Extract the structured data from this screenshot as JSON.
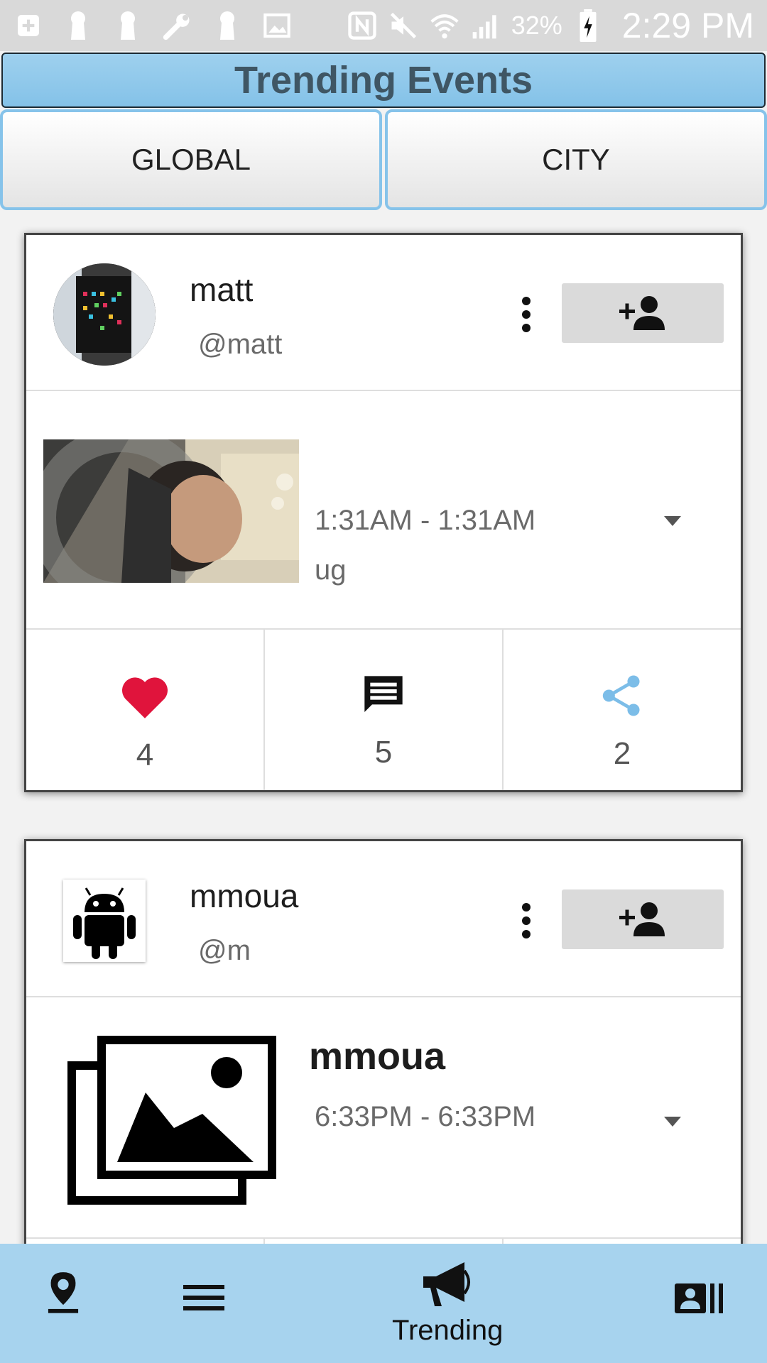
{
  "status_bar": {
    "battery": "32%",
    "time": "2:29 PM",
    "icons": [
      "add-box-icon",
      "keyhole-icon",
      "keyhole-icon",
      "wrench-icon",
      "keyhole-icon",
      "image-icon",
      "nfc-icon",
      "mute-icon",
      "wifi-icon",
      "signal-icon",
      "battery-charging-icon"
    ]
  },
  "header": {
    "title": "Trending Events"
  },
  "tabs": [
    {
      "label": "GLOBAL"
    },
    {
      "label": "CITY"
    }
  ],
  "posts": [
    {
      "username": "matt",
      "handle": "@matt",
      "time": "1:31AM - 1:31AM",
      "description": "ug",
      "likes": "4",
      "comments": "5",
      "shares": "2"
    },
    {
      "username": "mmoua",
      "handle": "@m",
      "title": "mmoua",
      "time": "6:33PM - 6:33PM"
    }
  ],
  "bottom_nav": {
    "items": [
      "map-pin-icon",
      "menu-icon",
      "megaphone-icon",
      "contacts-icon"
    ],
    "active_label": "Trending"
  },
  "colors": {
    "accent": "#86c3ea",
    "heart": "#e0143c",
    "share": "#7cbde8",
    "nav_bg": "#a7d3ee"
  }
}
